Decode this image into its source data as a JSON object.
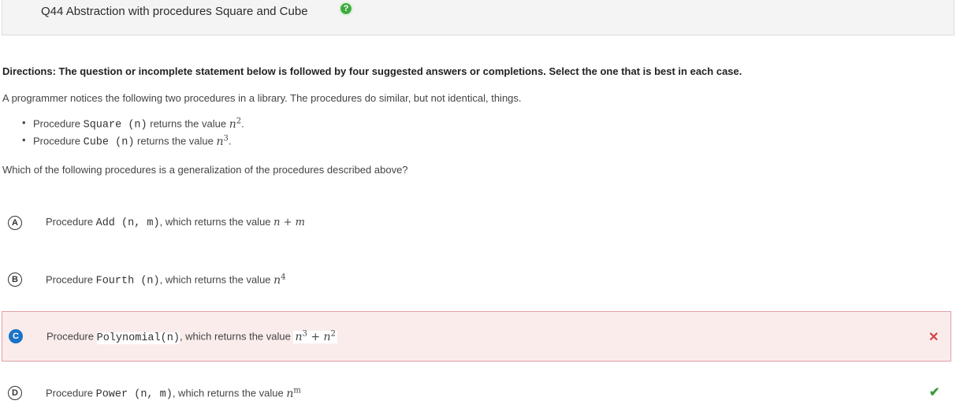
{
  "header": {
    "title": "Q44 Abstraction with procedures Square and Cube",
    "help_glyph": "?"
  },
  "directions": "Directions: The question or incomplete statement below is followed by four suggested answers or completions. Select the one that is best in each case.",
  "intro": "A programmer notices the following two procedures in a library. The procedures do similar, but not identical, things.",
  "bullets": [
    {
      "prefix": "Procedure",
      "code": "Square (n)",
      "middle": "returns the value",
      "base": "n",
      "exp": "2",
      "suffix": "."
    },
    {
      "prefix": "Procedure",
      "code": "Cube (n)",
      "middle": "returns the value",
      "base": "n",
      "exp": "3",
      "suffix": "."
    }
  ],
  "question": "Which of the following procedures is a generalization of the procedures described above?",
  "answers": [
    {
      "letter": "A",
      "prefix": "Procedure",
      "code": "Add (n, m)",
      "middle": ", which returns the value",
      "math": "n + m",
      "state": "normal"
    },
    {
      "letter": "B",
      "prefix": "Procedure",
      "code": "Fourth (n)",
      "middle": ", which returns the value",
      "base": "n",
      "exp": "4",
      "state": "normal"
    },
    {
      "letter": "C",
      "prefix": "Procedure",
      "code": "Polynomial(n)",
      "middle": ", which returns the value",
      "base": "n",
      "exp": "3",
      "plus": " + ",
      "base2": "n",
      "exp2": "2",
      "state": "selected-incorrect",
      "mark": "✕"
    },
    {
      "letter": "D",
      "prefix": "Procedure",
      "code": "Power (n, m)",
      "middle": ", which returns the value",
      "base": "n",
      "exp": "m",
      "state": "correct",
      "mark": "✔"
    }
  ],
  "colors": {
    "selected": "#1a73c8",
    "wrong_bg": "#fbecec",
    "wrong_border": "#e0a0a6",
    "correct": "#3a9a3a",
    "incorrect": "#d14444"
  }
}
